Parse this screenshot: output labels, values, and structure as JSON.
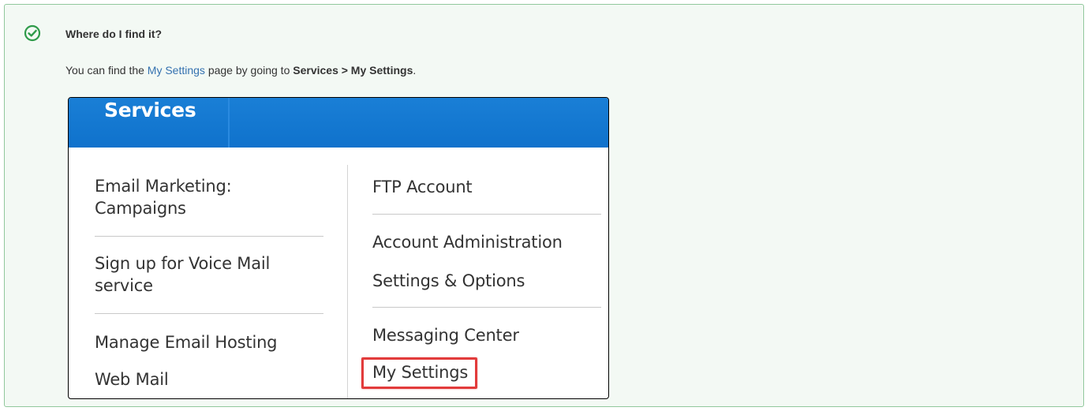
{
  "tip": {
    "icon": "check-circle-icon",
    "accent_color": "#2f9b4a",
    "title": "Where do I find it?",
    "body_prefix": "You can find the ",
    "link_text": "My Settings",
    "body_middle": " page by going to ",
    "path_text": "Services > My Settings",
    "body_suffix": "."
  },
  "screenshot": {
    "tab_label": "Services",
    "left_column": [
      "Email Marketing: Campaigns",
      "Sign up for Voice Mail service",
      "Manage Email Hosting",
      "Web Mail"
    ],
    "right_column": [
      "FTP Account",
      "Account Administration",
      "Settings & Options",
      "Messaging Center",
      "My Settings"
    ],
    "highlighted_item": "My Settings",
    "highlight_color": "#e23b3b",
    "header_color": "#1478d0"
  }
}
